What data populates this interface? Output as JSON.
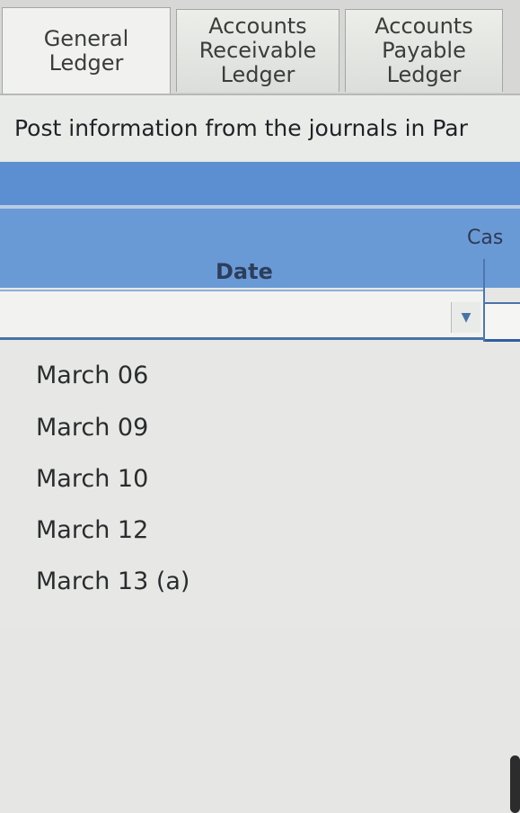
{
  "tabs": [
    {
      "label": "General\nLedger",
      "active": true
    },
    {
      "label": "Accounts\nReceivable\nLedger",
      "active": false
    },
    {
      "label": "Accounts\nPayable\nLedger",
      "active": false
    }
  ],
  "instruction": "Post information from the journals in Par",
  "table": {
    "column_header_partial": "Cas",
    "date_header": "Date"
  },
  "dropdown": {
    "options": [
      "March 06",
      "March 09",
      "March 10",
      "March 12",
      "March 13 (a)"
    ]
  },
  "colors": {
    "header_blue": "#5b8fd1",
    "header_blue_light": "#6a9ad6"
  }
}
